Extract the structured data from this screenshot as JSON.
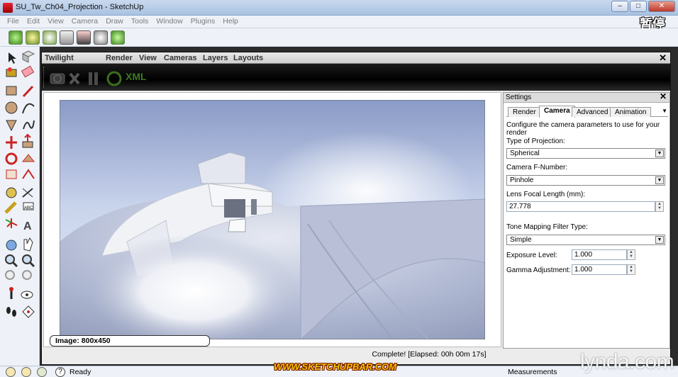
{
  "window": {
    "title": "SU_Tw_Ch04_Projection - SketchUp",
    "buttons": {
      "minimize": "‒",
      "maximize": "□",
      "close": "✕"
    }
  },
  "menubar": {
    "items": [
      "File",
      "Edit",
      "View",
      "Camera",
      "Draw",
      "Tools",
      "Window",
      "Plugins",
      "Help"
    ]
  },
  "overlay": {
    "pause_label": "暂停",
    "site_watermark": "WWW.SKETCHUPBAR.COM",
    "lynda_watermark": "lynda.com"
  },
  "toolbar": {
    "icons": [
      "power-icon",
      "sun-icon",
      "cursor-star-icon",
      "camera-icon",
      "magic-wand-icon",
      "gear-icon",
      "download-icon"
    ]
  },
  "twilight": {
    "title": "Twilight",
    "menu": [
      "Render",
      "View",
      "Cameras",
      "Layers",
      "Layouts"
    ],
    "close": "✕",
    "toolbar": {
      "xml_label": "XML"
    },
    "image_label": "Image: 800x450",
    "status": "Complete!  [Elapsed: 00h 00m 17s]"
  },
  "settings": {
    "title": "Settings",
    "close": "✕",
    "tabs": [
      "Render",
      "Camera",
      "Advanced",
      "Animation"
    ],
    "active_tab": "Camera",
    "description": "Configure the camera parameters to use for your render",
    "projection_label": "Type of Projection:",
    "projection_value": "Spherical",
    "fnumber_label": "Camera F-Number:",
    "fnumber_value": "Pinhole",
    "focal_label": "Lens Focal Length (mm):",
    "focal_value": "27.778",
    "tone_label": "Tone Mapping Filter Type:",
    "tone_value": "Simple",
    "exposure_label": "Exposure Level:",
    "exposure_value": "1.000",
    "gamma_label": "Gamma Adjustment:",
    "gamma_value": "1.000"
  },
  "statusbar": {
    "ready": "Ready",
    "measurements": "Measurements"
  }
}
